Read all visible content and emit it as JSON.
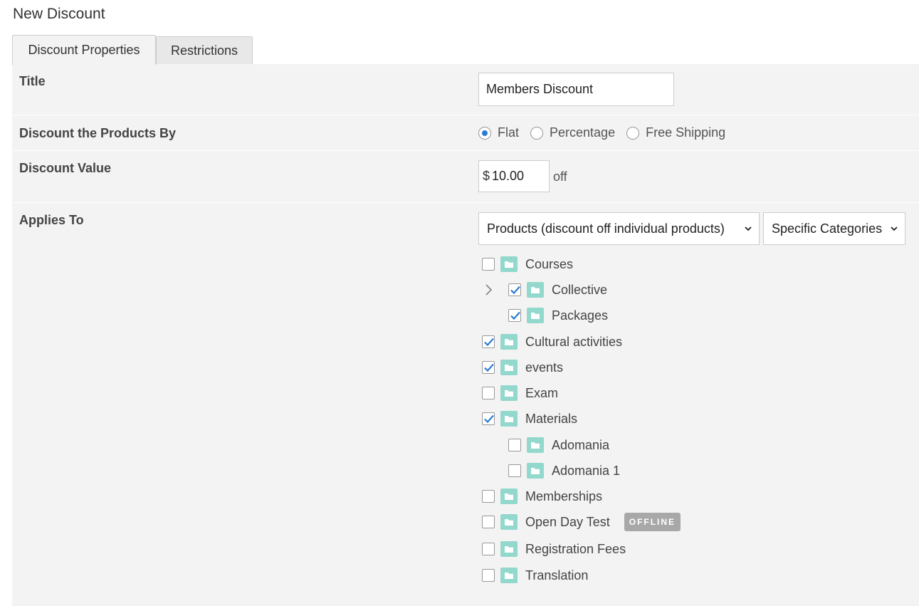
{
  "page": {
    "title": "New Discount"
  },
  "tabs": [
    {
      "label": "Discount Properties",
      "active": true
    },
    {
      "label": "Restrictions",
      "active": false
    }
  ],
  "form": {
    "title_label": "Title",
    "title_value": "Members Discount",
    "discount_by_label": "Discount the Products By",
    "discount_by_options": [
      {
        "label": "Flat",
        "checked": true
      },
      {
        "label": "Percentage",
        "checked": false
      },
      {
        "label": "Free Shipping",
        "checked": false
      }
    ],
    "discount_value_label": "Discount Value",
    "currency_symbol": "$",
    "discount_value": "10.00",
    "off_text": "off",
    "applies_to_label": "Applies To",
    "applies_to_select": "Products (discount off individual products)",
    "scope_select": "Specific Categories"
  },
  "categories": [
    {
      "label": "Courses",
      "checked": false,
      "level": 0
    },
    {
      "label": "Collective",
      "checked": true,
      "level": 1,
      "expandable": true
    },
    {
      "label": "Packages",
      "checked": true,
      "level": 1
    },
    {
      "label": "Cultural activities",
      "checked": true,
      "level": 0
    },
    {
      "label": "events",
      "checked": true,
      "level": 0
    },
    {
      "label": "Exam",
      "checked": false,
      "level": 0
    },
    {
      "label": "Materials",
      "checked": true,
      "level": 0
    },
    {
      "label": "Adomania",
      "checked": false,
      "level": 1
    },
    {
      "label": "Adomania 1",
      "checked": false,
      "level": 1
    },
    {
      "label": "Memberships",
      "checked": false,
      "level": 0
    },
    {
      "label": "Open Day Test",
      "checked": false,
      "level": 0,
      "badge": "OFFLINE"
    },
    {
      "label": "Registration Fees",
      "checked": false,
      "level": 0
    },
    {
      "label": "Translation",
      "checked": false,
      "level": 0
    }
  ],
  "colors": {
    "folder": "#93d8cc",
    "check": "#2c7ad1",
    "panel_bg": "#f3f3f3",
    "badge_bg": "#a8a8a8"
  }
}
